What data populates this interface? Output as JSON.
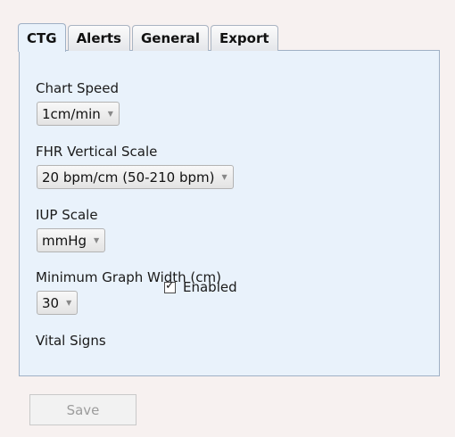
{
  "tabs": [
    {
      "label": "CTG",
      "active": true
    },
    {
      "label": "Alerts",
      "active": false
    },
    {
      "label": "General",
      "active": false
    },
    {
      "label": "Export",
      "active": false
    }
  ],
  "settings": {
    "chart_speed": {
      "label": "Chart Speed",
      "value": "1cm/min"
    },
    "fhr_scale": {
      "label": "FHR Vertical Scale",
      "value": "20 bpm/cm (50-210 bpm)"
    },
    "iup_scale": {
      "label": "IUP Scale",
      "value": "mmHg"
    },
    "min_graph_width": {
      "label": "Minimum Graph Width (cm)",
      "value": "30"
    },
    "vital_signs": {
      "label": "Vital Signs",
      "checkbox_label": "Enabled",
      "checked": true
    }
  },
  "dropdown_arrow_icon": "chevron-down-icon",
  "save_label": "Save",
  "colors": {
    "panel_background": "#e9f2fb",
    "window_background": "#f7f1f0",
    "disabled_text": "#9c9c9c"
  }
}
